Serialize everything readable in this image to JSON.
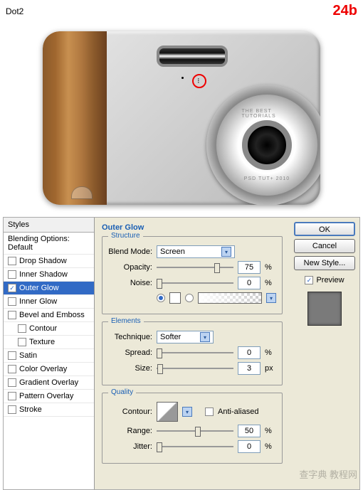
{
  "header": {
    "title": "Dot2",
    "badge": "24b"
  },
  "lens": {
    "top_text": "THE BEST TUTORIALS",
    "bottom_text": "PSD TUT+ 2010"
  },
  "styles": {
    "header": "Styles",
    "blending": "Blending Options: Default",
    "items": [
      {
        "label": "Drop Shadow",
        "checked": false,
        "indent": false,
        "selected": false
      },
      {
        "label": "Inner Shadow",
        "checked": false,
        "indent": false,
        "selected": false
      },
      {
        "label": "Outer Glow",
        "checked": true,
        "indent": false,
        "selected": true
      },
      {
        "label": "Inner Glow",
        "checked": false,
        "indent": false,
        "selected": false
      },
      {
        "label": "Bevel and Emboss",
        "checked": false,
        "indent": false,
        "selected": false
      },
      {
        "label": "Contour",
        "checked": false,
        "indent": true,
        "selected": false
      },
      {
        "label": "Texture",
        "checked": false,
        "indent": true,
        "selected": false
      },
      {
        "label": "Satin",
        "checked": false,
        "indent": false,
        "selected": false
      },
      {
        "label": "Color Overlay",
        "checked": false,
        "indent": false,
        "selected": false
      },
      {
        "label": "Gradient Overlay",
        "checked": false,
        "indent": false,
        "selected": false
      },
      {
        "label": "Pattern Overlay",
        "checked": false,
        "indent": false,
        "selected": false
      },
      {
        "label": "Stroke",
        "checked": false,
        "indent": false,
        "selected": false
      }
    ]
  },
  "outer_glow": {
    "title": "Outer Glow",
    "structure": {
      "legend": "Structure",
      "blend_mode_label": "Blend Mode:",
      "blend_mode_value": "Screen",
      "opacity_label": "Opacity:",
      "opacity_value": "75",
      "opacity_unit": "%",
      "noise_label": "Noise:",
      "noise_value": "0",
      "noise_unit": "%",
      "color_hex": "#ffffff"
    },
    "elements": {
      "legend": "Elements",
      "technique_label": "Technique:",
      "technique_value": "Softer",
      "spread_label": "Spread:",
      "spread_value": "0",
      "spread_unit": "%",
      "size_label": "Size:",
      "size_value": "3",
      "size_unit": "px"
    },
    "quality": {
      "legend": "Quality",
      "contour_label": "Contour:",
      "anti_aliased_label": "Anti-aliased",
      "range_label": "Range:",
      "range_value": "50",
      "range_unit": "%",
      "jitter_label": "Jitter:",
      "jitter_value": "0",
      "jitter_unit": "%"
    }
  },
  "buttons": {
    "ok": "OK",
    "cancel": "Cancel",
    "new_style": "New Style...",
    "preview": "Preview"
  },
  "watermark": "查字典 教程网"
}
